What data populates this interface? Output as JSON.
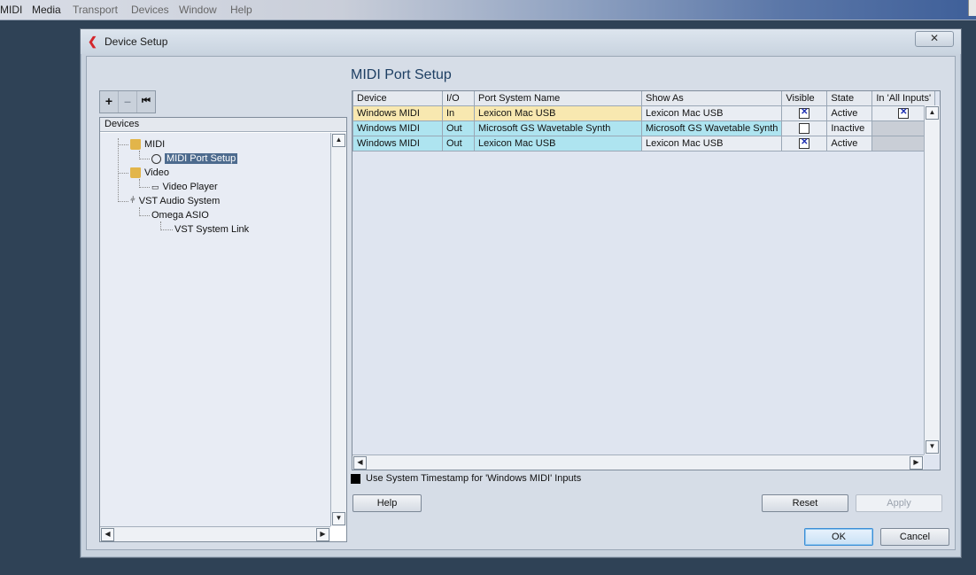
{
  "host_menu": [
    "MIDI",
    "Media",
    "Transport",
    "Devices",
    "Window",
    "Help"
  ],
  "dialog": {
    "title": "Device Setup",
    "close_label": "✕",
    "toolbar": {
      "add": "+",
      "remove": "–",
      "reset": "⏮"
    }
  },
  "devices": {
    "header": "Devices",
    "tree": [
      {
        "label": "MIDI",
        "icon": "folder-icon"
      },
      {
        "label": "MIDI Port Setup",
        "icon": "midi-port-icon",
        "selected": true
      },
      {
        "label": "Video",
        "icon": "folder-icon"
      },
      {
        "label": "Video Player",
        "icon": "video-player-icon"
      },
      {
        "label": "VST Audio System",
        "icon": "audio-system-icon"
      },
      {
        "label": "Omega ASIO",
        "icon": ""
      },
      {
        "label": "VST System Link",
        "icon": ""
      }
    ]
  },
  "midi_port_setup": {
    "title": "MIDI Port Setup",
    "columns": [
      "Device",
      "I/O",
      "Port System Name",
      "Show As",
      "Visible",
      "State",
      "In 'All Inputs'"
    ],
    "rows": [
      {
        "device": "Windows MIDI",
        "io": "In",
        "port": "Lexicon Mac USB",
        "show_as": "Lexicon Mac USB",
        "visible": true,
        "state": "Active",
        "all_inputs": true
      },
      {
        "device": "Windows MIDI",
        "io": "Out",
        "port": "Microsoft GS Wavetable Synth",
        "show_as": "Microsoft GS Wavetable Synth",
        "visible": false,
        "state": "Inactive",
        "all_inputs": null
      },
      {
        "device": "Windows MIDI",
        "io": "Out",
        "port": "Lexicon Mac USB",
        "show_as": "Lexicon Mac USB",
        "visible": true,
        "state": "Active",
        "all_inputs": null
      }
    ],
    "timestamp_option": "Use System Timestamp for 'Windows MIDI' Inputs"
  },
  "buttons": {
    "help": "Help",
    "reset": "Reset",
    "apply": "Apply",
    "ok": "OK",
    "cancel": "Cancel"
  }
}
